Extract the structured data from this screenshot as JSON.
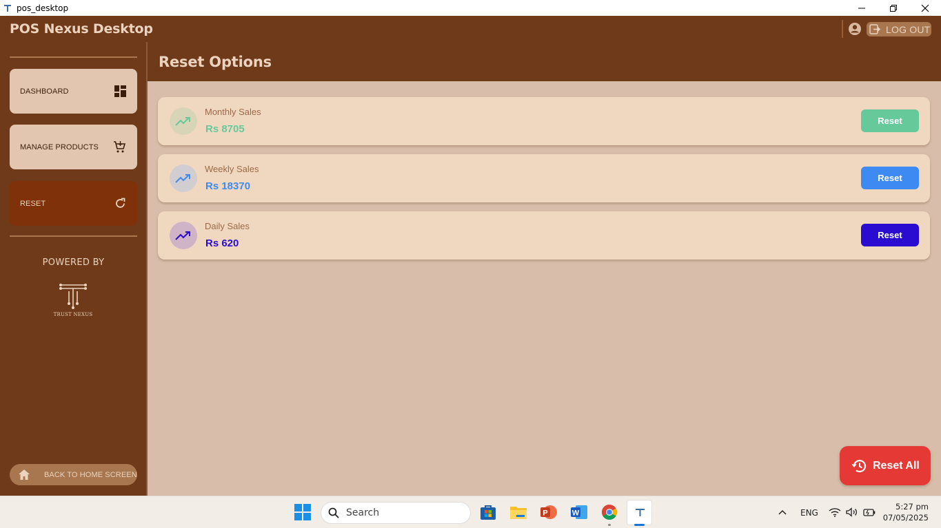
{
  "window": {
    "title": "pos_desktop"
  },
  "appbar": {
    "brand": "POS Nexus Desktop",
    "logout_label": "LOG OUT"
  },
  "sidebar": {
    "items": [
      {
        "label": "DASHBOARD",
        "icon": "dashboard-icon",
        "active": false
      },
      {
        "label": "MANAGE PRODUCTS",
        "icon": "cart-icon",
        "active": false
      },
      {
        "label": "RESET",
        "icon": "refresh-icon",
        "active": true
      }
    ],
    "powered_by": "POWERED BY",
    "logo_text": "TRUST NEXUS",
    "home_label": "BACK TO HOME SCREEN"
  },
  "page": {
    "title": "Reset Options"
  },
  "cards": [
    {
      "name": "Monthly Sales",
      "amount": "Rs 8705",
      "button": "Reset",
      "color": "#66c99a",
      "circle": "#d8d4b8"
    },
    {
      "name": "Weekly Sales",
      "amount": "Rs 18370",
      "button": "Reset",
      "color": "#3d8bf2",
      "circle": "#d2cdd0"
    },
    {
      "name": "Daily Sales",
      "amount": "Rs 620",
      "button": "Reset",
      "color": "#2a0bd0",
      "circle": "#cfb3c6"
    }
  ],
  "reset_all_label": "Reset All",
  "taskbar": {
    "search_placeholder": "Search",
    "language": "ENG",
    "time": "5:27 pm",
    "date": "07/05/2025"
  },
  "colors": {
    "brown": "#6e3a1a",
    "background": "#d8beaa",
    "card": "#f0d8c0",
    "accent_red": "#e53935"
  }
}
